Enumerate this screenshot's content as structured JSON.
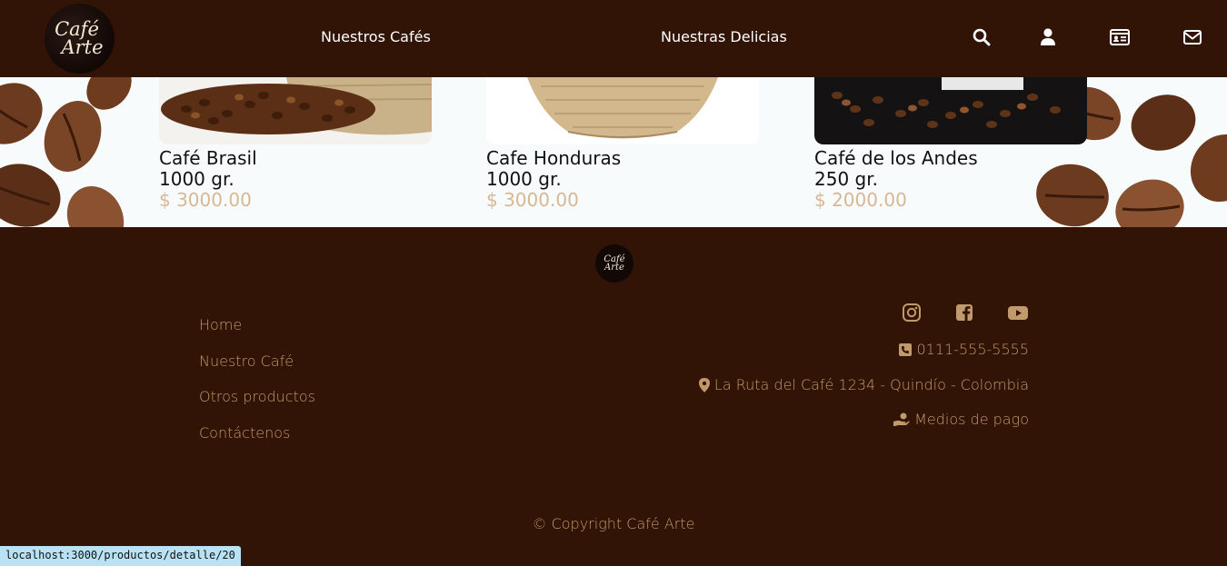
{
  "header": {
    "logo_line1": "Café",
    "logo_line2": "Arte",
    "nav": [
      {
        "label": "Nuestros Cafés"
      },
      {
        "label": "Nuestras Delicias"
      }
    ],
    "icons": [
      "search-icon",
      "user-icon",
      "id-card-icon",
      "envelope-icon"
    ]
  },
  "products": [
    {
      "name": "Café Brasil",
      "weight": "1000 gr.",
      "price": "$ 3000.00"
    },
    {
      "name": "Cafe Honduras",
      "weight": "1000 gr.",
      "price": "$ 3000.00"
    },
    {
      "name": "Café de los Andes",
      "weight": "250 gr.",
      "price": "$ 2000.00"
    }
  ],
  "footer": {
    "logo_line1": "Café",
    "logo_line2": "Arte",
    "links": [
      {
        "label": "Home"
      },
      {
        "label": "Nuestro Café"
      },
      {
        "label": "Otros productos"
      },
      {
        "label": "Contáctenos"
      }
    ],
    "social": [
      "instagram-icon",
      "facebook-icon",
      "youtube-icon"
    ],
    "phone": "0111-555-5555",
    "address": "La Ruta del Café 1234 - Quindío - Colombia",
    "payment": "Medios de pago",
    "copyright": "© Copyright Café Arte"
  },
  "status_bar": {
    "url": "localhost:3000/productos/detalle/20"
  },
  "colors": {
    "brown_bg": "#311405",
    "accent_tan": "#c19a6b",
    "price_tan": "#d8b794"
  }
}
